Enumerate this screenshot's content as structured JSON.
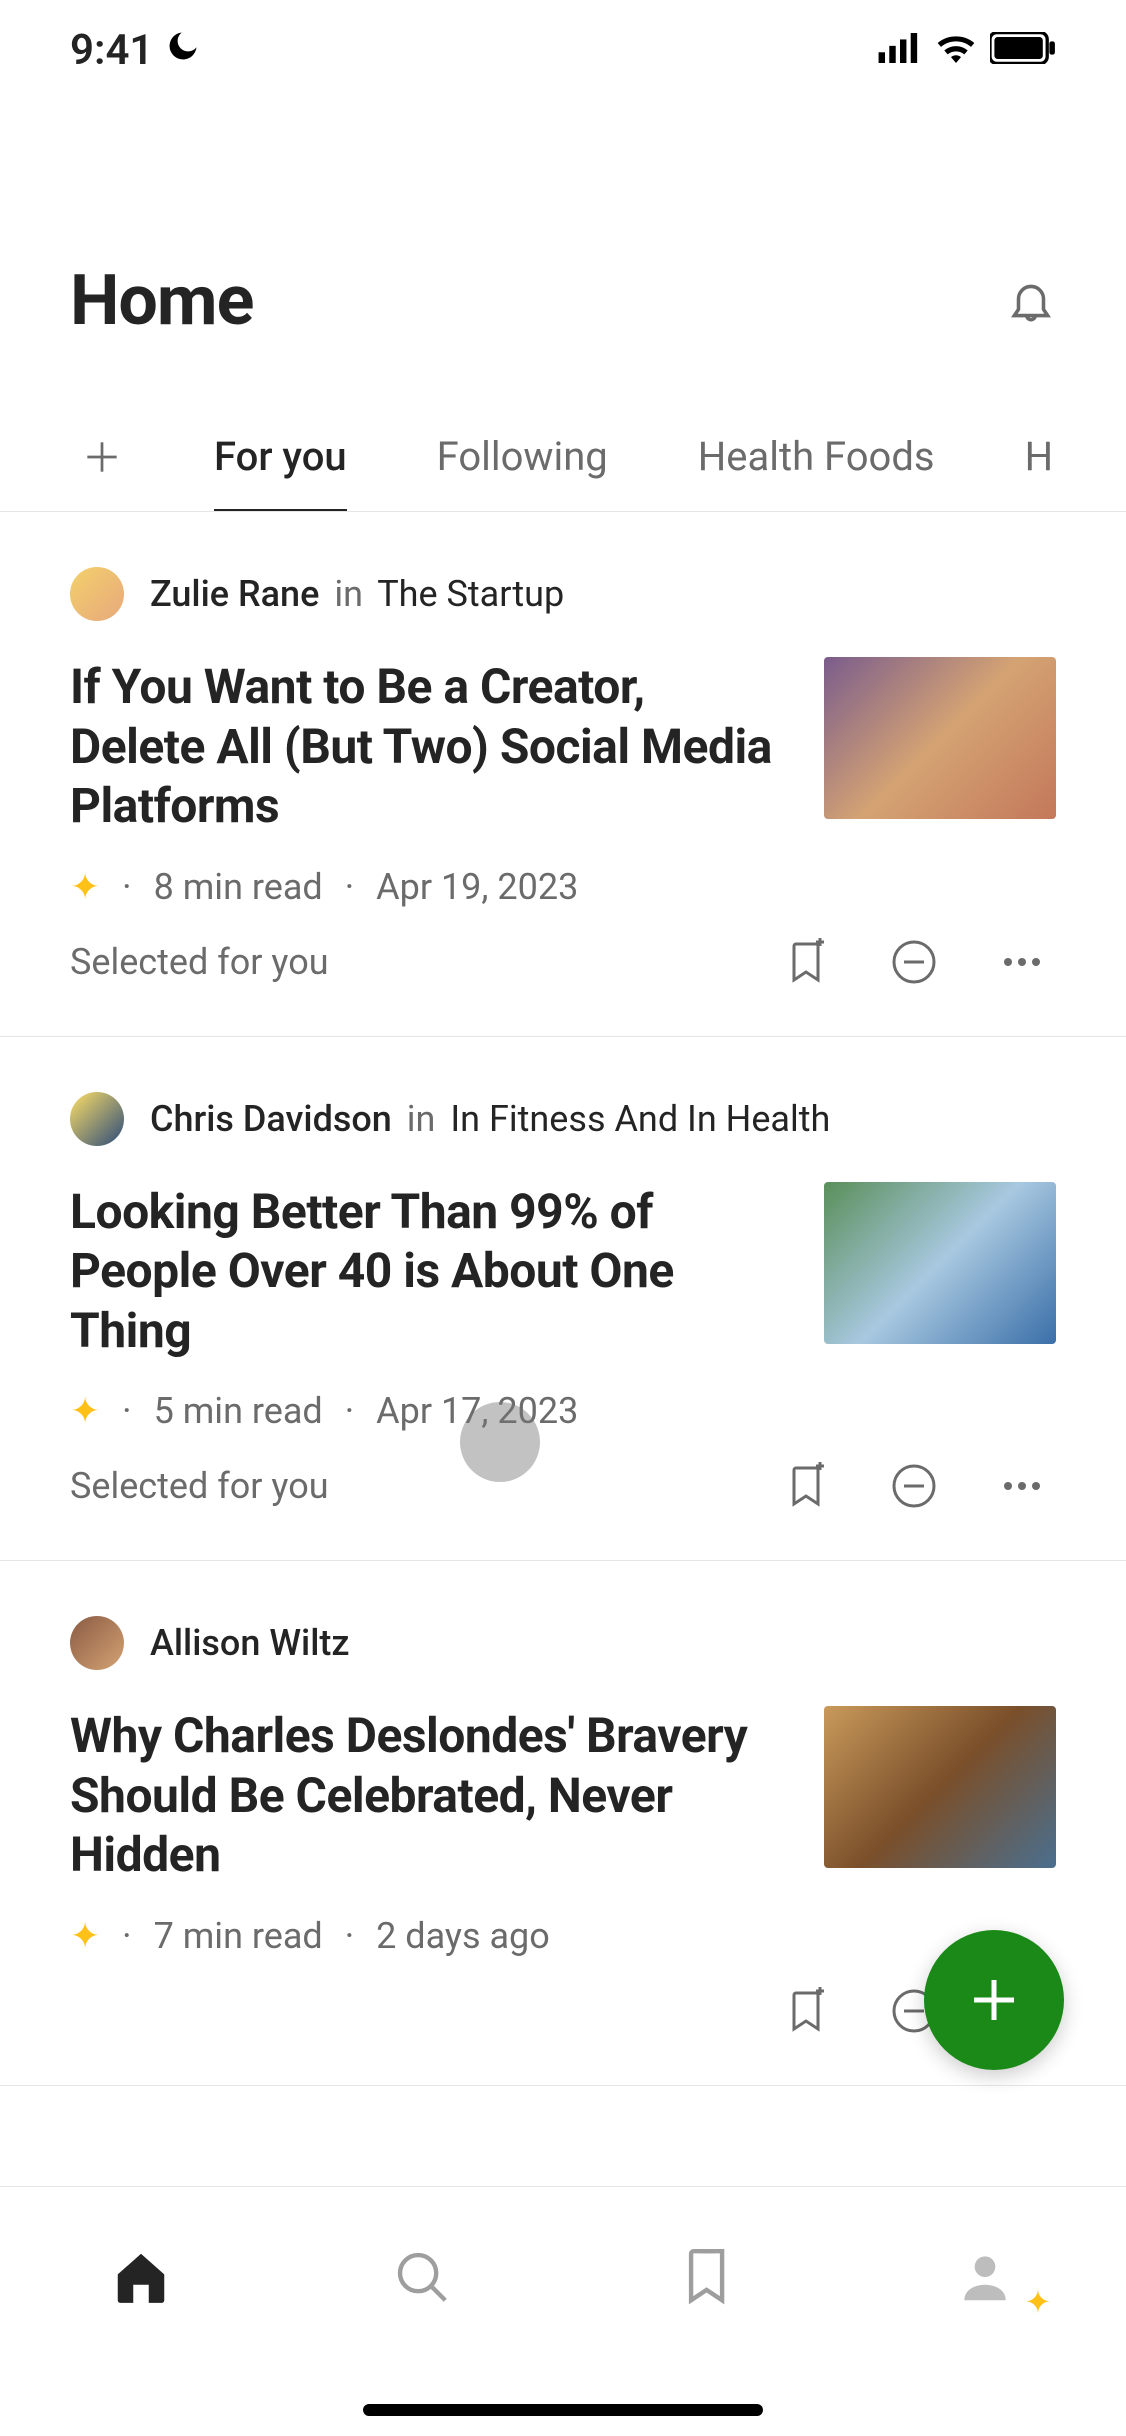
{
  "status": {
    "time": "9:41"
  },
  "header": {
    "title": "Home"
  },
  "tabs": [
    {
      "label": "For you",
      "active": true
    },
    {
      "label": "Following",
      "active": false
    },
    {
      "label": "Health Foods",
      "active": false
    },
    {
      "label": "H",
      "active": false
    }
  ],
  "feed": [
    {
      "author": "Zulie Rane",
      "in": "in",
      "publication": "The Startup",
      "title": "If You Want to Be a Creator, Delete All (But Two) Social Media Platforms",
      "read_time": "8  min read",
      "date": "Apr 19, 2023",
      "tag": "Selected for you",
      "member_only": true
    },
    {
      "author": "Chris Davidson",
      "in": "in",
      "publication": "In Fitness And In Health",
      "title": "Looking Better Than 99% of People Over 40 is About One Thing",
      "read_time": "5  min read",
      "date": "Apr 17, 2023",
      "tag": "Selected for you",
      "member_only": true
    },
    {
      "author": "Allison Wiltz",
      "in": "",
      "publication": "",
      "title": "Why Charles Deslondes' Bravery Should Be Celebrated, Never Hidden",
      "read_time": "7  min read",
      "date": "2 days ago",
      "tag": "",
      "member_only": true
    }
  ]
}
